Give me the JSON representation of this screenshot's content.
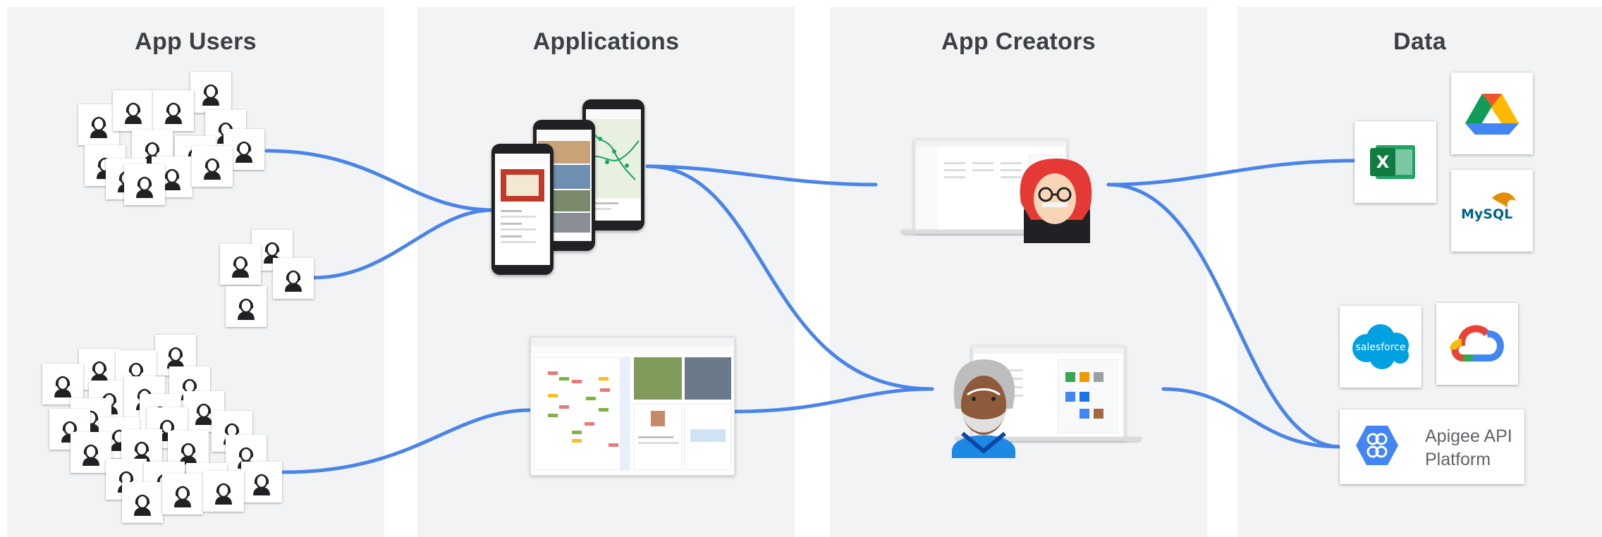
{
  "columns": {
    "app_users": "App Users",
    "applications": "Applications",
    "app_creators": "App Creators",
    "data": "Data"
  },
  "data_sources": {
    "excel_icon": "excel-icon",
    "drive_icon": "google-drive-icon",
    "mysql_label": "MySQL",
    "salesforce_label": "salesforce",
    "gcloud_icon": "google-cloud-icon",
    "apigee_line1": "Apigee API",
    "apigee_line2": "Platform"
  },
  "colors": {
    "connector": "#4a84e8",
    "column_bg": "#f1f3f4",
    "title": "#3c4043"
  }
}
